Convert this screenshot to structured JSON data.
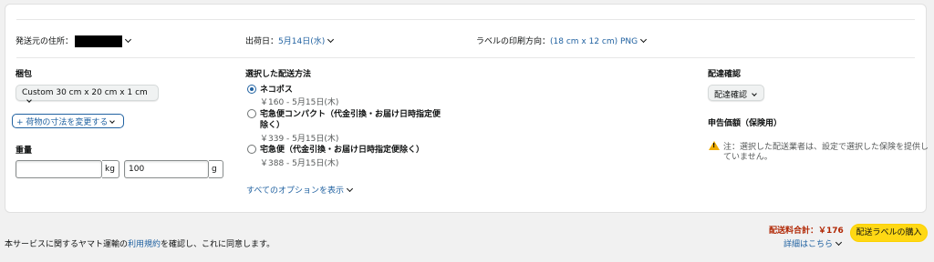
{
  "header": {
    "origin_label": "発送元の住所：",
    "ship_date_label": "出荷日：",
    "ship_date_value": "5月14日(水)",
    "label_orient_label": "ラベルの印刷方向：",
    "label_orient_value": "(18 cm x 12 cm) PNG"
  },
  "package": {
    "heading": "梱包",
    "selected": "Custom 30 cm x 20 cm x 1 cm",
    "change_button": "+ 荷物の寸法を変更する"
  },
  "weight": {
    "heading": "重量",
    "kg_value": "",
    "kg_unit": "kg",
    "g_value": "100",
    "g_unit": "g"
  },
  "shipping": {
    "heading": "選択した配送方法",
    "options": [
      {
        "name": "ネコポス",
        "price": "￥160 - 5月15日(木)"
      },
      {
        "name": "宅急便コンパクト（代金引換・お届け日時指定便除く）",
        "name_line1": "宅急便コンパクト（代金引換・お届け日時指定便",
        "name_line2": "除く）",
        "price": "￥339 - 5月15日(木)"
      },
      {
        "name": "宅急便（代金引換・お届け日時指定便除く）",
        "price": "￥388 - 5月15日(木)"
      }
    ],
    "all_options_link": "すべてのオプションを表示"
  },
  "confirmation": {
    "heading": "配達確認",
    "selected": "配達確認",
    "declared_heading": "申告価額（保険用）",
    "note_line1": "注：選択した配送業者は、設定で選択した保険を提供し",
    "note_line2": "ていません。"
  },
  "footer": {
    "terms_prefix": "本サービスに関するヤマト運輸の",
    "terms_link": "利用規約",
    "terms_suffix": "を確認し、これに同意します。",
    "total_label": "配送料合計：￥176",
    "details_link": "詳細はこちら",
    "buy_button": "配送ラベルの購入"
  },
  "colors": {
    "link": "#2162a1",
    "total": "#b12704",
    "buy_button": "#ffd814",
    "warning": "#f0ad00"
  }
}
